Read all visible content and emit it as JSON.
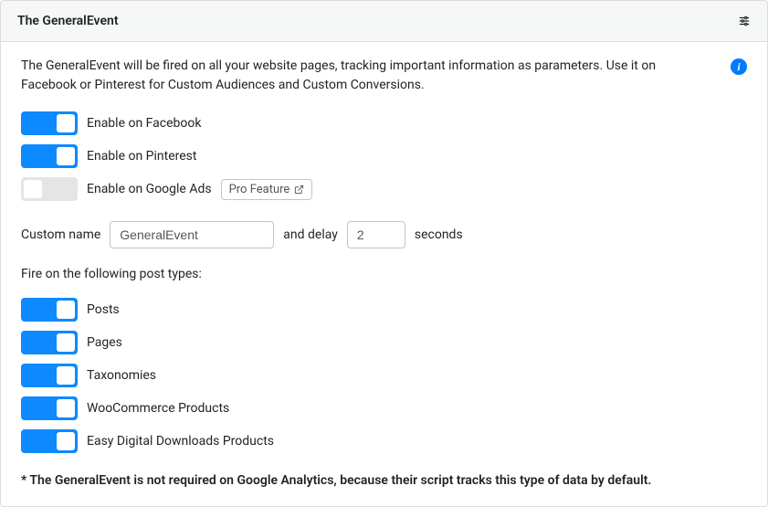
{
  "header": {
    "title": "The GeneralEvent"
  },
  "description": "The GeneralEvent will be fired on all your website pages, tracking important information as parameters. Use it on Facebook or Pinterest for Custom Audiences and Custom Conversions.",
  "info_icon": "i",
  "enable_section": {
    "items": [
      {
        "label": "Enable on Facebook",
        "on": true
      },
      {
        "label": "Enable on Pinterest",
        "on": true
      },
      {
        "label": "Enable on Google Ads",
        "on": false,
        "pro": true
      }
    ],
    "pro_label": "Pro Feature"
  },
  "custom": {
    "name_label": "Custom name",
    "name_value": "GeneralEvent",
    "delay_prefix": "and delay",
    "delay_value": "2",
    "delay_suffix": "seconds"
  },
  "post_types": {
    "title": "Fire on the following post types:",
    "items": [
      {
        "label": "Posts",
        "on": true
      },
      {
        "label": "Pages",
        "on": true
      },
      {
        "label": "Taxonomies",
        "on": true
      },
      {
        "label": "WooCommerce Products",
        "on": true
      },
      {
        "label": "Easy Digital Downloads Products",
        "on": true
      }
    ]
  },
  "footnote": "* The GeneralEvent is not required on Google Analytics, because their script tracks this type of data by default."
}
